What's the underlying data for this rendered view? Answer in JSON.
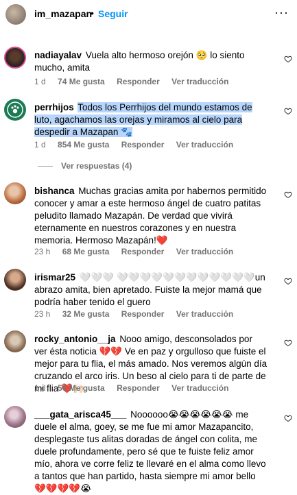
{
  "header": {
    "username": "im_mazapan",
    "dot": "•",
    "follow_label": "Seguir",
    "more_label": "···"
  },
  "actions": {
    "reply_label": "Responder",
    "translate_label": "Ver traducción"
  },
  "comments": [
    {
      "user": "nadiayalav",
      "text": "Vuela alto hermoso orejón 🥺  lo siento mucho, amita",
      "time": "1 d",
      "likes": "74 Me gusta"
    },
    {
      "user": "perrhijos",
      "text": "Todos los Perrhijos del mundo estamos de luto, agachamos las orejas y miramos al cielo para despedir a Mazapan 🐾",
      "time": "1 d",
      "likes": "854 Me gusta",
      "replies": "Ver respuestas (4)"
    },
    {
      "user": "bishanca",
      "text": "Muchas gracias amita por habernos permitido conocer y amar a este hermoso ángel de cuatro patitas peludito llamado Mazapán. De verdad que vivirá eternamente en nuestros corazones y en nuestra memoria. Hermoso Mazapán!❤️",
      "time": "23 h",
      "likes": "68 Me gusta"
    },
    {
      "user": "irismar25",
      "text": "🤍🤍🤍 🤍🤍🤍🤍🤍🤍🤍🤍🤍🤍🤍🤍un abrazo amita, bien apretado. Fuiste la mejor mamá que podría haber tenido el guero",
      "time": "23 h",
      "likes": "32 Me gusta"
    },
    {
      "user": "rocky_antonio__ja",
      "text": "Nooo amigo, desconsolados por ver ésta noticia 💔💔  Ve en paz y orgulloso que fuiste el mejor para tu flia, el más amado. Nos veremos algún día cruzando el arco iris. Un beso al cielo para ti de parte de mi flia ❤️🙌🏻",
      "time": "1 d",
      "likes": "56 Me gusta"
    },
    {
      "user": "___gata_arisca45___",
      "text": "Noooooo😭😭😭😭😭😭 me duele el alma, goey, se me fue mi amor Mazapancito, desplegaste tus alitas doradas de ángel con colita, me duele profundamente, pero sé que te fuiste feliz amor mío, ahora ve corre feliz te llevaré en el alma como llevo a tantos que han partido, hasta siempre mi amor bello 💔💔💔💔😭"
    }
  ]
}
